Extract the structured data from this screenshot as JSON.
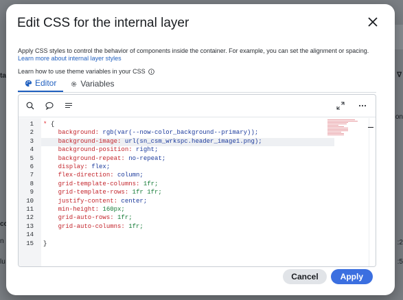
{
  "modal": {
    "title": "Edit CSS for the internal layer",
    "description": "Apply CSS styles to control the behavior of components inside the container. For example, you can set the alignment or spacing.",
    "learn_more_link": "Learn more about internal layer styles",
    "theme_text": "Learn how to use theme variables in your CSS",
    "tabs": [
      {
        "label": "Editor",
        "active": true,
        "icon": "palette-icon"
      },
      {
        "label": "Variables",
        "active": false,
        "icon": "gear-icon"
      }
    ],
    "cancel_label": "Cancel",
    "apply_label": "Apply"
  },
  "background": {
    "frag_ta": "ta",
    "frag_v": "∇",
    "frag_on": "on",
    "frag_cc": "cc",
    "frag_n": "n",
    "frag_lu": "lu",
    "frag_a2": ":2",
    "frag_a5": ":5"
  },
  "editor": {
    "lines": [
      {
        "n": "1",
        "tokens": [
          {
            "t": "* ",
            "c": "star"
          },
          {
            "t": "{",
            "c": "punct"
          }
        ]
      },
      {
        "n": "2",
        "tokens": [
          {
            "t": "    background: ",
            "c": "prop"
          },
          {
            "t": "rgb(var(--now-color_background--primary));",
            "c": "val"
          }
        ]
      },
      {
        "n": "3",
        "tokens": [
          {
            "t": "    background-image: ",
            "c": "prop"
          },
          {
            "t": "url(sn_csm_wrkspc.header_image1.png);",
            "c": "val"
          }
        ]
      },
      {
        "n": "4",
        "tokens": [
          {
            "t": "    background-position: ",
            "c": "prop"
          },
          {
            "t": "right;",
            "c": "val"
          }
        ]
      },
      {
        "n": "5",
        "tokens": [
          {
            "t": "    background-repeat: ",
            "c": "prop"
          },
          {
            "t": "no-repeat;",
            "c": "val"
          }
        ]
      },
      {
        "n": "6",
        "tokens": [
          {
            "t": "    display: ",
            "c": "prop"
          },
          {
            "t": "flex;",
            "c": "val"
          }
        ]
      },
      {
        "n": "7",
        "tokens": [
          {
            "t": "    flex-direction: ",
            "c": "prop"
          },
          {
            "t": "column;",
            "c": "val"
          }
        ]
      },
      {
        "n": "8",
        "tokens": [
          {
            "t": "    grid-template-columns: ",
            "c": "prop"
          },
          {
            "t": "1fr;",
            "c": "num"
          }
        ]
      },
      {
        "n": "9",
        "tokens": [
          {
            "t": "    grid-template-rows: ",
            "c": "prop"
          },
          {
            "t": "1fr 1fr;",
            "c": "num"
          }
        ]
      },
      {
        "n": "10",
        "tokens": [
          {
            "t": "    justify-content: ",
            "c": "prop"
          },
          {
            "t": "center;",
            "c": "val"
          }
        ]
      },
      {
        "n": "11",
        "tokens": [
          {
            "t": "    min-height: ",
            "c": "prop"
          },
          {
            "t": "160px;",
            "c": "num"
          }
        ]
      },
      {
        "n": "12",
        "tokens": [
          {
            "t": "    grid-auto-rows: ",
            "c": "prop"
          },
          {
            "t": "1fr;",
            "c": "num"
          }
        ]
      },
      {
        "n": "13",
        "tokens": [
          {
            "t": "    grid-auto-columns: ",
            "c": "prop"
          },
          {
            "t": "1fr;",
            "c": "num"
          }
        ]
      },
      {
        "n": "14",
        "tokens": []
      },
      {
        "n": "15",
        "tokens": [
          {
            "t": "}",
            "c": "punct"
          }
        ]
      }
    ],
    "toolbar": [
      "search-icon",
      "comment-icon",
      "format-icon",
      "expand-icon",
      "more-icon"
    ]
  },
  "colors": {
    "accent": "#1f5fbf",
    "apply_button": "#3b6fe0",
    "property": "#c3242b",
    "value": "#1b3a9c",
    "number": "#137a35"
  }
}
